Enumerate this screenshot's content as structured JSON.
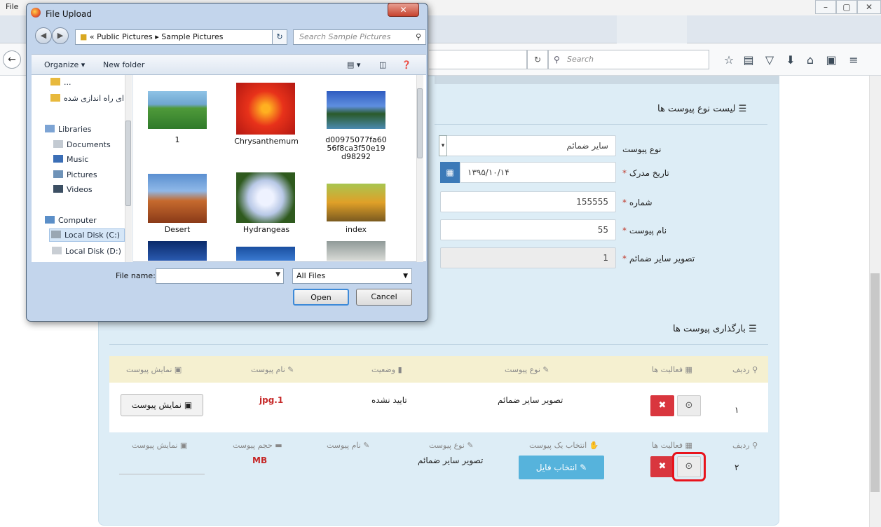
{
  "browser": {
    "menu_file": "File",
    "search_placeholder": "Search"
  },
  "dialog": {
    "title": "File Upload",
    "breadcrumb": "«  Public Pictures  ▸  Sample Pictures",
    "search_placeholder": "Search Sample Pictures",
    "organize_label": "Organize ▾",
    "new_folder_label": "New folder",
    "nav_items": [
      {
        "label": "...",
        "icon": "folder-icon"
      },
      {
        "label": "ای راه اندازی شده",
        "icon": "folder-icon"
      },
      {
        "label": "Libraries",
        "icon": "libraries-icon"
      },
      {
        "label": "Documents",
        "icon": "documents-icon"
      },
      {
        "label": "Music",
        "icon": "music-icon"
      },
      {
        "label": "Pictures",
        "icon": "pictures-icon"
      },
      {
        "label": "Videos",
        "icon": "videos-icon"
      },
      {
        "label": "Computer",
        "icon": "computer-icon"
      },
      {
        "label": "Local Disk (C:)",
        "icon": "disk-icon"
      },
      {
        "label": "Local Disk (D:)",
        "icon": "disk-icon"
      }
    ],
    "files": [
      {
        "name": "1"
      },
      {
        "name": "Chrysanthemum"
      },
      {
        "name": "d00975077fa6056f8ca3f50e19d98292"
      },
      {
        "name": "Desert"
      },
      {
        "name": "Hydrangeas"
      },
      {
        "name": "index"
      }
    ],
    "filename_label": "File name:",
    "filename_value": "",
    "filetype_value": "All Files",
    "open_label": "Open",
    "cancel_label": "Cancel"
  },
  "attachment_types": {
    "title": "لیست نوع پیوست ها",
    "fields": {
      "type_label": "نوع پیوست",
      "type_value": "سایر ضمائم",
      "date_label": "تاریخ مدرک",
      "date_value": "۱۳۹۵/۱۰/۱۴",
      "number_label": "شماره",
      "number_value": "155555",
      "name_label": "نام پیوست",
      "name_value": "55",
      "image_label": "تصویر سایر ضمائم",
      "image_value": "1",
      "required_mark": "*"
    }
  },
  "uploads": {
    "title": "بارگذاری پیوست ها",
    "table1": {
      "headers": {
        "row": "ردیف",
        "actions": "فعالیت ها",
        "type": "نوع پیوست",
        "status": "وضعیت",
        "name": "نام پیوست",
        "preview": "نمایش پیوست"
      },
      "row": {
        "index": "۱",
        "type": "تصویر سایر ضمائم",
        "status": "تایید نشده",
        "name": "jpg.1",
        "preview_button": "نمایش پیوست"
      }
    },
    "table2": {
      "headers": {
        "row": "ردیف",
        "actions": "فعالیت ها",
        "choose": "انتخاب یک پیوست",
        "type": "نوع پیوست",
        "name": "نام پیوست",
        "size": "حجم پیوست",
        "preview": "نمایش پیوست"
      },
      "row": {
        "index": "۲",
        "choose_button": "انتخاب فایل",
        "type": "تصویر سایر ضمائم",
        "size": "MB"
      }
    }
  },
  "colors": {
    "panel_bg": "#ddedf6",
    "delete_button": "#d9363e",
    "choose_button": "#56b3dc",
    "highlight": "#e8131c"
  }
}
